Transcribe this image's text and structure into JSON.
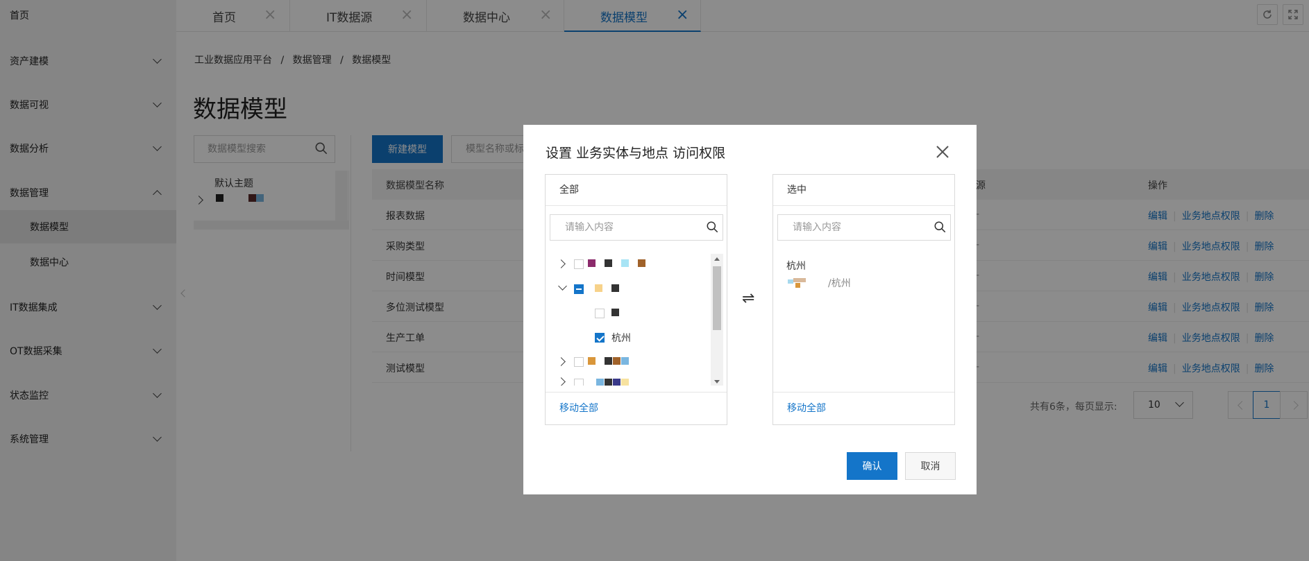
{
  "sidebar": {
    "home": "首页",
    "menus": [
      {
        "label": "资产建模",
        "expanded": false
      },
      {
        "label": "数据可视",
        "expanded": false
      },
      {
        "label": "数据分析",
        "expanded": false
      },
      {
        "label": "数据管理",
        "expanded": true
      },
      {
        "label": "IT数据集成",
        "expanded": false
      },
      {
        "label": "OT数据采集",
        "expanded": false
      },
      {
        "label": "状态监控",
        "expanded": false
      },
      {
        "label": "系统管理",
        "expanded": false
      }
    ],
    "sub_items": [
      {
        "label": "数据模型",
        "active": true
      },
      {
        "label": "数据中心",
        "active": false
      }
    ]
  },
  "tabs": [
    {
      "label": "首页",
      "active": false
    },
    {
      "label": "IT数据源",
      "active": false
    },
    {
      "label": "数据中心",
      "active": false
    },
    {
      "label": "数据模型",
      "active": true
    }
  ],
  "toolbar": {
    "refresh_icon": "refresh-icon",
    "fullscreen_icon": "fullscreen-icon"
  },
  "breadcrumb": {
    "items": [
      "工业数据应用平台",
      "数据管理",
      "数据模型"
    ],
    "separator": "/"
  },
  "page": {
    "title": "数据模型",
    "search_placeholder": "数据模型搜索",
    "tree_root": "默认主题",
    "new_button": "新建模型",
    "model_search_placeholder": "模型名称或标识"
  },
  "table": {
    "headers": {
      "name": "数据模型名称",
      "source": "源",
      "actions": "操作"
    },
    "rows": [
      {
        "name": "报表数据",
        "source": "-"
      },
      {
        "name": "采购类型",
        "source": "-"
      },
      {
        "name": "时间模型",
        "source": "-"
      },
      {
        "name": "多位测试模型",
        "source": "-"
      },
      {
        "name": "生产工单",
        "source": "-"
      },
      {
        "name": "测试模型",
        "source": "-"
      }
    ],
    "actions": {
      "edit": "编辑",
      "permission": "业务地点权限",
      "delete": "删除"
    }
  },
  "pagination": {
    "total_text": "共有6条，每页显示:",
    "page_size": "10",
    "current_page": "1"
  },
  "modal": {
    "title": "设置 业务实体与地点 访问权限",
    "left_panel": {
      "header": "全部",
      "search_placeholder": "请输入内容",
      "checked_item": "杭州",
      "move_all": "移动全部"
    },
    "right_panel": {
      "header": "选中",
      "search_placeholder": "请输入内容",
      "item_title": "杭州",
      "item_path_suffix": "/杭州",
      "move_all": "移动全部"
    },
    "transfer_icon": "⇌",
    "confirm": "确认",
    "cancel": "取消"
  },
  "colors": {
    "accent": "#1475c9",
    "sidebar_bg": "#f3f3f3",
    "overlay": "rgba(0,0,0,0.45)"
  }
}
